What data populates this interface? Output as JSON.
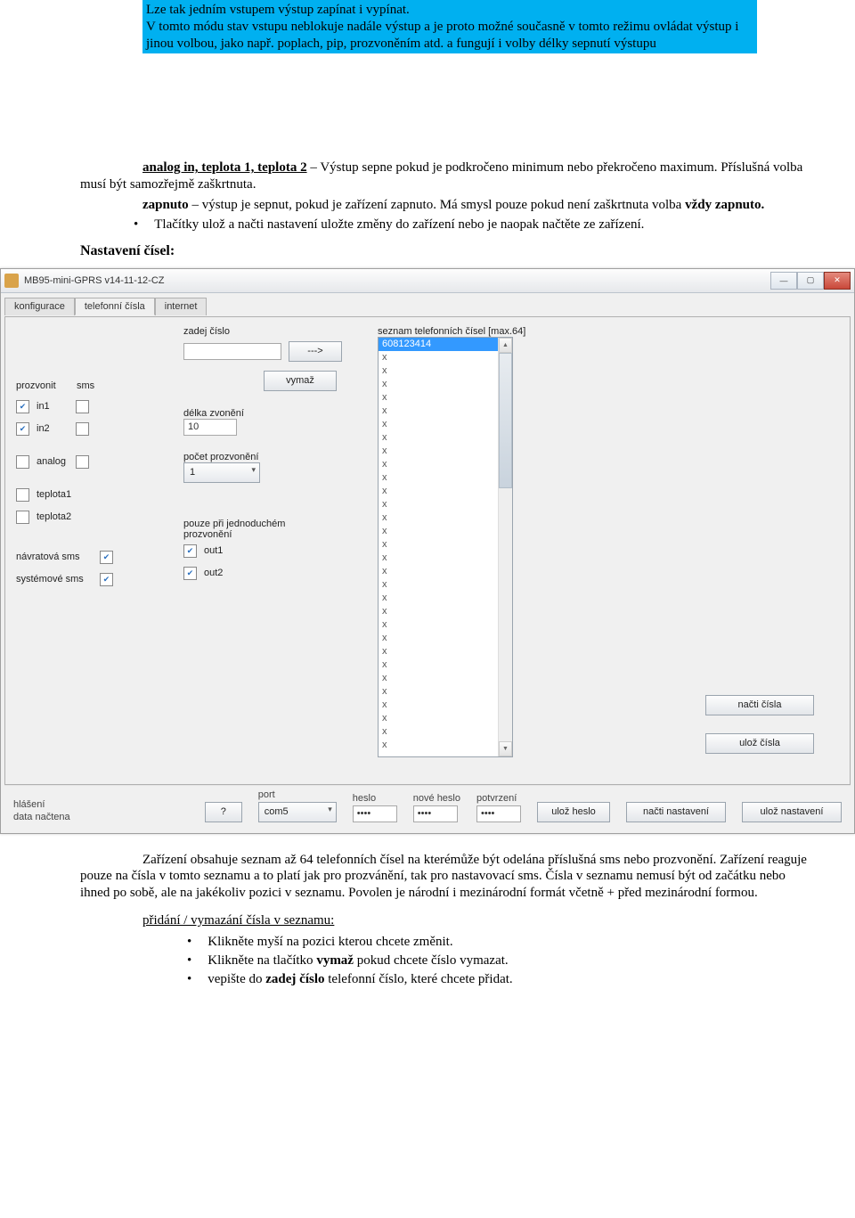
{
  "highlight": {
    "l1": "Lze tak jedním vstupem výstup zapínat i vypínat.",
    "l2": "V tomto módu stav vstupu neblokuje nadále výstup a je proto možné současně v tomto režimu ovládat výstup i jinou volbou, jako např. poplach, pip, prozvoněním atd. a fungují i volby délky sepnutí výstupu"
  },
  "body": {
    "analog_pre": "analog in, teplota 1, teplota 2",
    "analog_rest": " – Výstup sepne pokud je podkročeno minimum nebo překročeno maximum. Příslušná volba musí být samozřejmě zaškrtnuta.",
    "zap_pre": "zapnuto",
    "zap_rest": " – výstup je sepnut, pokud je zařízení zapnuto. Má smysl pouze pokud není zaškrtnuta volba ",
    "zap_bold2": "vždy zapnuto.",
    "bullet1": "Tlačítky ulož a načti nastavení uložte změny do zařízení nebo je naopak načtěte ze zařízení.",
    "section_heading": "Nastavení čísel:",
    "zarizeni": "Zařízení obsahuje seznam až 64 telefonních čísel na kterémůže být odelána příslušná sms nebo prozvonění. Zařízení reaguje pouze na čísla v tomto seznamu a to platí jak pro prozvánění, tak pro nastavovací sms. Čísla v seznamu nemusí být od začátku nebo ihned po sobě, ale na jakékoliv pozici v seznamu. Povolen je národní i mezinárodní formát včetně + před mezinárodní formou.",
    "pridani_hd": "přidání / vymazání čísla v seznamu:",
    "b2a_pre": "Klikněte myší na pozici kterou chcete změnit.",
    "b2b_pre": "Klikněte na tlačítko ",
    "b2b_bold": "vymaž",
    "b2b_post": " pokud chcete číslo vymazat.",
    "b2c_pre": "vepište do ",
    "b2c_bold": "zadej číslo",
    "b2c_post": "  telefonní číslo, které chcete přidat."
  },
  "win": {
    "title": "MB95-mini-GPRS v14-11-12-CZ",
    "tabs": {
      "konfigurace": "konfigurace",
      "telefon": "telefonní čísla",
      "internet": "internet"
    },
    "col1": {
      "prozvonit": "prozvonit",
      "sms": "sms",
      "in1": "in1",
      "in2": "in2",
      "analog": "analog",
      "teplota1": "teplota1",
      "teplota2": "teplota2",
      "navratova": "návratová sms",
      "systemova": "systémové sms"
    },
    "col2": {
      "zadej": "zadej číslo",
      "arrow": "--->",
      "vymaz": "vymaž",
      "delka": "délka zvonění",
      "delka_val": "10",
      "pocet": "počet prozvonění",
      "pocet_val": "1",
      "pouze": "pouze při jednoduchém prozvonění",
      "out1": "out1",
      "out2": "out2"
    },
    "col3": {
      "seznam": "seznam telefonních čísel [max.64]",
      "first": "608123414",
      "x": "x"
    },
    "col4": {
      "nacti": "načti čísla",
      "uloz": "ulož čísla"
    },
    "footer": {
      "hlaseni": "hlášení",
      "data_nactena": "data načtena",
      "q": "?",
      "port": "port",
      "port_val": "com5",
      "heslo": "heslo",
      "nove": "nové heslo",
      "potvr": "potvrzení",
      "pwd": "••••",
      "uloz_heslo": "ulož heslo",
      "nacti_nast": "načti nastavení",
      "uloz_nast": "ulož nastavení"
    }
  }
}
